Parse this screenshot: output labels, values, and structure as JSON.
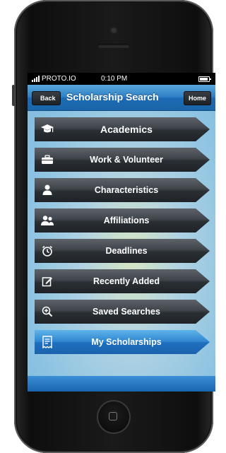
{
  "statusbar": {
    "carrier": "PROTO.IO",
    "time": "0:10 PM"
  },
  "navbar": {
    "back_label": "Back",
    "title": "Scholarship Search",
    "home_label": "Home"
  },
  "menu": {
    "items": [
      {
        "label": "Academics",
        "icon": "graduation-cap-icon"
      },
      {
        "label": "Work & Volunteer",
        "icon": "toolbox-icon"
      },
      {
        "label": "Characteristics",
        "icon": "person-icon"
      },
      {
        "label": "Affiliations",
        "icon": "group-icon"
      },
      {
        "label": "Deadlines",
        "icon": "alarm-clock-icon"
      },
      {
        "label": "Recently Added",
        "icon": "edit-icon"
      },
      {
        "label": "Saved Searches",
        "icon": "zoom-in-icon"
      },
      {
        "label": "My Scholarships",
        "icon": "document-list-icon",
        "selected": true
      }
    ]
  },
  "colors": {
    "nav_blue": "#2d7fc5",
    "item_dark": "#2a2f34",
    "selected_blue": "#2f86d1"
  }
}
